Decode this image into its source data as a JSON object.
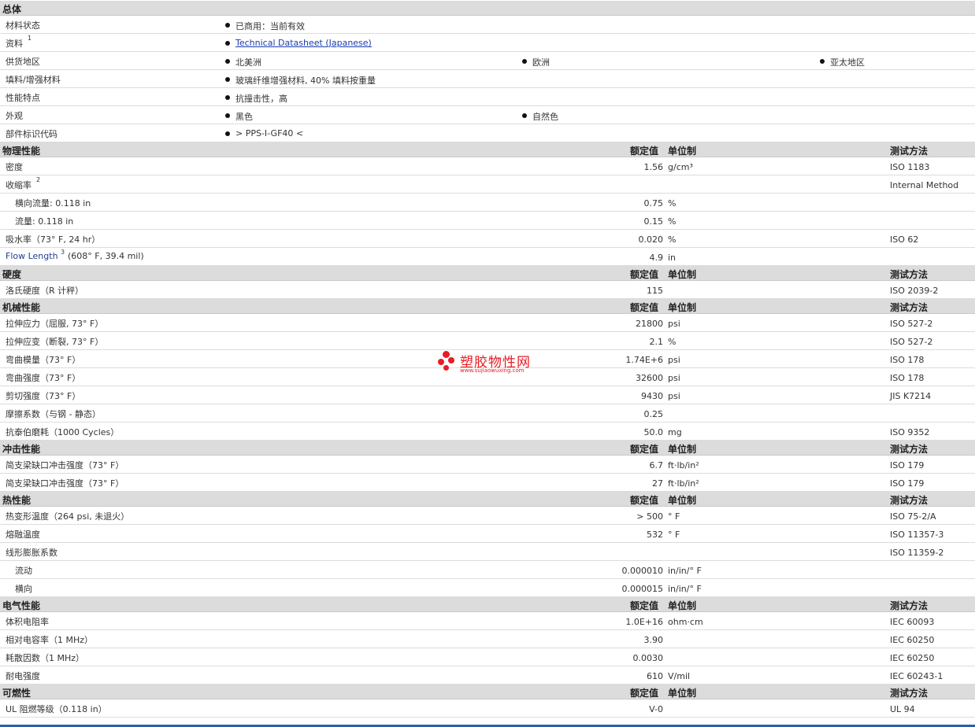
{
  "general": {
    "header": "总体",
    "rows": [
      {
        "label": "材料状态",
        "items": [
          "已商用：当前有效"
        ]
      },
      {
        "label": "资料",
        "sup": "1",
        "items": [
          "Technical Datasheet (Japanese)"
        ]
      },
      {
        "label": "供货地区",
        "items": [
          "北美洲",
          "欧洲",
          "亚太地区"
        ]
      },
      {
        "label": "填料/增强材料",
        "items": [
          "玻璃纤维增强材料, 40% 填料按重量"
        ]
      },
      {
        "label": "性能特点",
        "items": [
          "抗撞击性，高"
        ]
      },
      {
        "label": "外观",
        "items": [
          "黑色",
          "自然色"
        ]
      },
      {
        "label": "部件标识代码",
        "items": [
          "> PPS-I-GF40 <"
        ]
      }
    ]
  },
  "columns": {
    "value": "额定值",
    "unit": "单位制",
    "method": "测试方法"
  },
  "sections": [
    {
      "title": "物理性能",
      "rows": [
        {
          "label": "密度",
          "value": "1.56",
          "unit": "g/cm³",
          "method": "ISO 1183"
        },
        {
          "label": "收缩率",
          "sup": "2",
          "value": "",
          "unit": "",
          "method": "Internal Method"
        },
        {
          "label": "横向流量: 0.118 in",
          "sub": true,
          "value": "0.75",
          "unit": "%",
          "method": ""
        },
        {
          "label": "流量: 0.118 in",
          "sub": true,
          "value": "0.15",
          "unit": "%",
          "method": ""
        },
        {
          "label": "吸水率（73° F, 24 hr）",
          "value": "0.020",
          "unit": "%",
          "method": "ISO 62"
        },
        {
          "label": "Flow Length",
          "sup": "3",
          "label2": "(608° F, 39.4 mil)",
          "blue": true,
          "value": "4.9",
          "unit": "in",
          "method": ""
        }
      ]
    },
    {
      "title": "硬度",
      "rows": [
        {
          "label": "洛氏硬度（R 计秤）",
          "value": "115",
          "unit": "",
          "method": "ISO 2039-2"
        }
      ]
    },
    {
      "title": "机械性能",
      "rows": [
        {
          "label": "拉伸应力（屈服, 73° F）",
          "value": "21800",
          "unit": "psi",
          "method": "ISO 527-2"
        },
        {
          "label": "拉伸应变（断裂, 73° F）",
          "value": "2.1",
          "unit": "%",
          "method": "ISO 527-2"
        },
        {
          "label": "弯曲模量（73° F）",
          "value": "1.74E+6",
          "unit": "psi",
          "method": "ISO 178"
        },
        {
          "label": "弯曲强度（73° F）",
          "value": "32600",
          "unit": "psi",
          "method": "ISO 178"
        },
        {
          "label": "剪切强度（73° F）",
          "value": "9430",
          "unit": "psi",
          "method": "JIS K7214"
        },
        {
          "label": "摩擦系数（与钢 - 静态）",
          "value": "0.25",
          "unit": "",
          "method": ""
        },
        {
          "label": "抗泰伯磨耗（1000 Cycles）",
          "value": "50.0",
          "unit": "mg",
          "method": "ISO 9352"
        }
      ]
    },
    {
      "title": "冲击性能",
      "rows": [
        {
          "label": "简支梁缺口冲击强度（73° F）",
          "value": "6.7",
          "unit": "ft·lb/in²",
          "method": "ISO 179"
        },
        {
          "label": "简支梁缺口冲击强度（73° F）",
          "value": "27",
          "unit": "ft·lb/in²",
          "method": "ISO 179"
        }
      ]
    },
    {
      "title": "热性能",
      "rows": [
        {
          "label": "热变形温度（264 psi, 未退火）",
          "value": "> 500",
          "unit": "° F",
          "method": "ISO 75-2/A"
        },
        {
          "label": "熔融温度",
          "value": "532",
          "unit": "° F",
          "method": "ISO 11357-3"
        },
        {
          "label": "线形膨胀系数",
          "value": "",
          "unit": "",
          "method": "ISO 11359-2"
        },
        {
          "label": "流动",
          "sub": true,
          "value": "0.000010",
          "unit": "in/in/° F",
          "method": ""
        },
        {
          "label": "横向",
          "sub": true,
          "value": "0.000015",
          "unit": "in/in/° F",
          "method": ""
        }
      ]
    },
    {
      "title": "电气性能",
      "rows": [
        {
          "label": "体积电阻率",
          "value": "1.0E+16",
          "unit": "ohm·cm",
          "method": "IEC 60093"
        },
        {
          "label": "相对电容率（1 MHz）",
          "value": "3.90",
          "unit": "",
          "method": "IEC 60250"
        },
        {
          "label": "耗散因数（1 MHz）",
          "value": "0.0030",
          "unit": "",
          "method": "IEC 60250"
        },
        {
          "label": "耐电强度",
          "value": "610",
          "unit": "V/mil",
          "method": "IEC 60243-1"
        }
      ]
    },
    {
      "title": "可燃性",
      "rows": [
        {
          "label": "UL 阻燃等级（0.118 in）",
          "value": "V-0",
          "unit": "",
          "method": "UL 94"
        }
      ]
    }
  ],
  "watermark": {
    "name": "塑胶物性网",
    "url": "www.sujiaowuxing.com"
  }
}
